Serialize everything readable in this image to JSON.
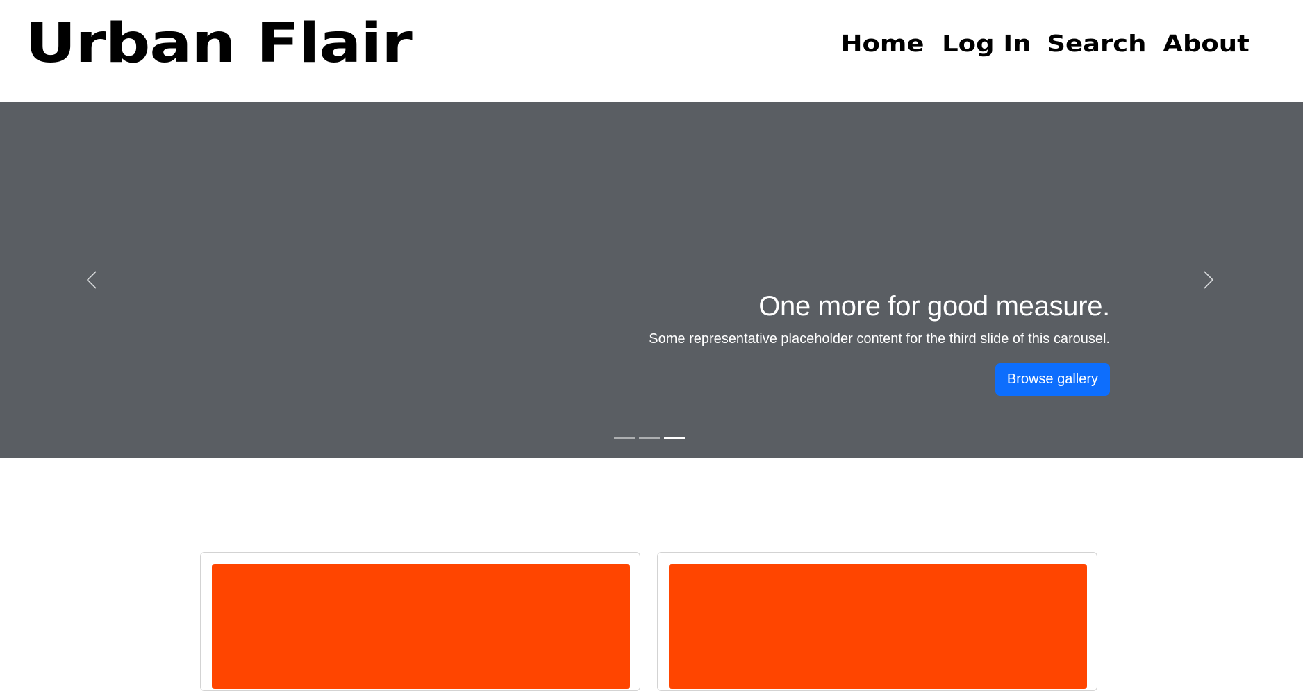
{
  "header": {
    "brand": "Urban Flair",
    "nav": [
      {
        "label": "Home"
      },
      {
        "label": "Log In"
      },
      {
        "label": "Search"
      },
      {
        "label": "About"
      }
    ]
  },
  "carousel": {
    "slide_title": "One more for good measure.",
    "slide_text": "Some representative placeholder content for the third slide of this carousel.",
    "button_label": "Browse gallery",
    "active_index": 3,
    "slide_count": 3,
    "background_color": "#5a5e63"
  },
  "cards": {
    "accent_color": "#ff4500",
    "items": [
      {
        "image_color": "#ff4500"
      },
      {
        "image_color": "#ff4500"
      }
    ]
  },
  "colors": {
    "primary_button": "#0d6efd"
  }
}
